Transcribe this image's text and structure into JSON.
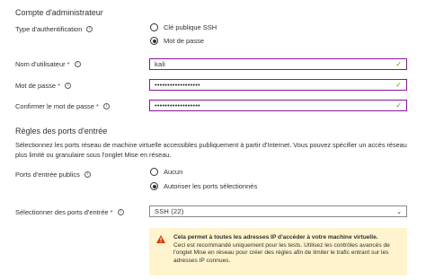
{
  "admin": {
    "section_title": "Compte d'administrateur",
    "auth_type_label": "Type d'authentification",
    "auth_options": [
      "Clé publique SSH",
      "Mot de passe"
    ],
    "auth_selected": "Mot de passe",
    "username_label": "Nom d'utilisateur",
    "username_value": "kali",
    "password_label": "Mot de passe",
    "password_value": "••••••••••••••••••",
    "confirm_label": "Confirmer le mot de passe",
    "confirm_value": "••••••••••••••••••",
    "required_mark": "*"
  },
  "inbound": {
    "section_title": "Règles des ports d'entrée",
    "description": "Sélectionnez les ports réseau de machine virtuelle accessibles publiquement à partir d'Internet. Vous pouvez spécifier un accès réseau plus limité ou granulaire sous l'onglet Mise en réseau.",
    "public_ports_label": "Ports d'entrée publics",
    "public_ports_options": [
      "Aucun",
      "Autoriser les ports sélectionnés"
    ],
    "public_ports_selected": "Autoriser les ports sélectionnés",
    "select_ports_label": "Sélectionner des ports d'entrée",
    "select_ports_value": "SSH (22)"
  },
  "warning": {
    "title": "Cela permet à toutes les adresses IP d'accéder à votre machine virtuelle.",
    "body": "Ceci est recommandé uniquement pour les tests.  Utilisez les contrôles avancés de l'onglet Mise en réseau pour créer des règles afin de limiter le trafic entrant sur les adresses IP connues."
  },
  "icons": {
    "info": "info-icon",
    "check": "checkmark-icon",
    "chevron": "chevron-down-icon",
    "warning": "warning-triangle-icon"
  },
  "colors": {
    "focus_border": "#881798",
    "valid_check": "#57a300",
    "required": "#a4262c",
    "warning_bg": "#fff4ce",
    "warning_icon": "#d83b01"
  }
}
